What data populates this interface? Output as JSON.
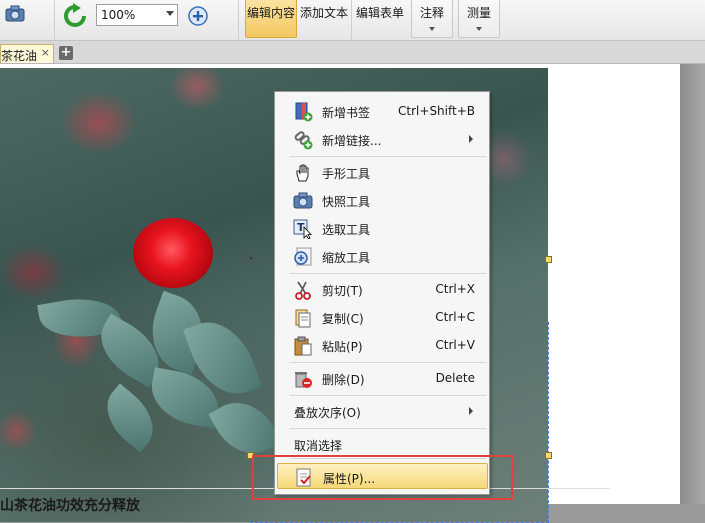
{
  "toolbar": {
    "zoom_value": "100%",
    "buttons": {
      "edit_content": "编辑内容",
      "add_text": "添加文本",
      "edit_form": "编辑表单",
      "annotate": "注释",
      "measure": "测量"
    }
  },
  "tabs": [
    {
      "label": "茶花油",
      "close": "×"
    }
  ],
  "new_tab": "+",
  "document": {
    "heading_fragment": "山茶花油功效充分释放"
  },
  "menu": {
    "items": [
      {
        "label": "新增书签",
        "shortcut": "Ctrl+Shift+B",
        "icon": "bookmark-add-icon"
      },
      {
        "label": "新增链接...",
        "shortcut": "",
        "icon": "link-add-icon",
        "submenu": true
      },
      {
        "label": "手形工具",
        "shortcut": "",
        "icon": "hand-icon"
      },
      {
        "label": "快照工具",
        "shortcut": "",
        "icon": "camera-icon"
      },
      {
        "label": "选取工具",
        "shortcut": "",
        "icon": "select-text-icon"
      },
      {
        "label": "缩放工具",
        "shortcut": "",
        "icon": "zoom-icon"
      },
      {
        "label": "剪切(T)",
        "shortcut": "Ctrl+X",
        "icon": "scissors-icon"
      },
      {
        "label": "复制(C)",
        "shortcut": "Ctrl+C",
        "icon": "copy-icon"
      },
      {
        "label": "粘贴(P)",
        "shortcut": "Ctrl+V",
        "icon": "paste-icon"
      },
      {
        "label": "删除(D)",
        "shortcut": "Delete",
        "icon": "delete-icon"
      },
      {
        "label": "叠放次序(O)",
        "shortcut": "",
        "submenu": true
      },
      {
        "label": "取消选择",
        "shortcut": ""
      },
      {
        "label": "属性(P)...",
        "shortcut": "",
        "icon": "properties-icon",
        "highlighted": true
      }
    ]
  },
  "colors": {
    "highlight": "#f6d978",
    "callout_frame": "#e0413f",
    "selection": "#4a7bd6"
  }
}
